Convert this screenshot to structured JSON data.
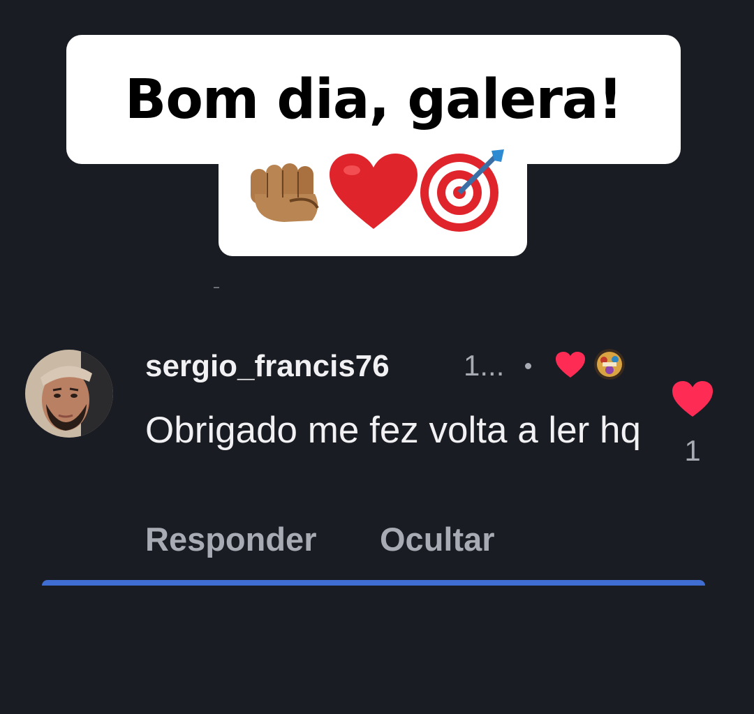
{
  "caption": {
    "title": "Bom dia, galera!",
    "emojis": [
      "fist-bump-emoji",
      "red-heart-emoji",
      "direct-hit-emoji"
    ]
  },
  "comment": {
    "username": "sergio_francis76",
    "timestamp": "1...",
    "text": "Obrigado me fez volta a ler hq",
    "liked_by_creator": true,
    "like_count": "1",
    "actions": {
      "reply": "Responder",
      "hide": "Ocultar"
    }
  },
  "colors": {
    "background": "#1a1c23",
    "heart": "#fe2c55",
    "accent_bar": "#3f6dd1",
    "muted_text": "#a8abb3"
  }
}
